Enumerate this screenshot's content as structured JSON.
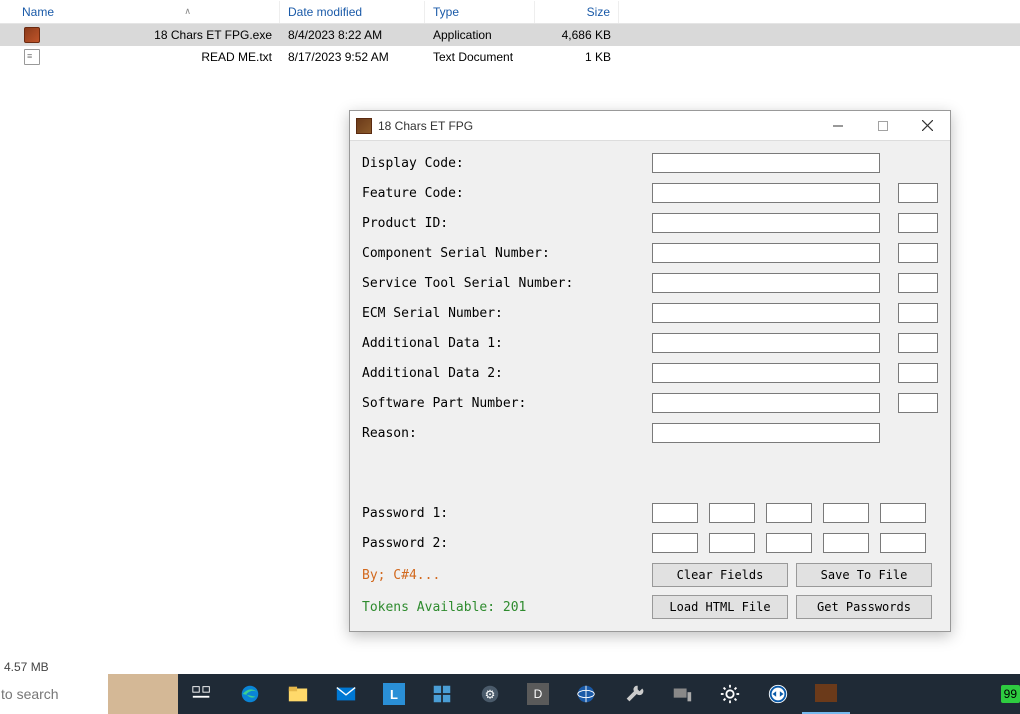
{
  "explorer": {
    "headers": {
      "name": "Name",
      "date": "Date modified",
      "type": "Type",
      "size": "Size"
    },
    "rows": [
      {
        "name": "18 Chars ET FPG.exe",
        "date": "8/4/2023 8:22 AM",
        "type": "Application",
        "size": "4,686 KB",
        "selected": true,
        "icon": "exe"
      },
      {
        "name": "READ ME.txt",
        "date": "8/17/2023 9:52 AM",
        "type": "Text Document",
        "size": "1 KB",
        "selected": false,
        "icon": "txt"
      }
    ],
    "status": "4.57 MB"
  },
  "dialog": {
    "title": "18 Chars ET FPG",
    "fields": [
      {
        "label": "Display Code:",
        "has_small": false
      },
      {
        "label": "Feature Code:",
        "has_small": true
      },
      {
        "label": "Product ID:",
        "has_small": true
      },
      {
        "label": "Component Serial Number:",
        "has_small": true
      },
      {
        "label": "Service Tool Serial Number:",
        "has_small": true
      },
      {
        "label": "ECM Serial Number:",
        "has_small": true
      },
      {
        "label": "Additional Data 1:",
        "has_small": true
      },
      {
        "label": "Additional Data 2:",
        "has_small": true
      },
      {
        "label": "Software Part Number:",
        "has_small": true
      },
      {
        "label": "Reason:",
        "has_small": false
      }
    ],
    "pw1_label": "Password 1:",
    "pw2_label": "Password 2:",
    "credit": "By; C#4...",
    "tokens": "Tokens Available: 201",
    "buttons": {
      "clear": "Clear Fields",
      "save": "Save To File",
      "load": "Load HTML File",
      "get": "Get Passwords"
    }
  },
  "taskbar": {
    "search_placeholder": "to search",
    "badge": "99"
  }
}
